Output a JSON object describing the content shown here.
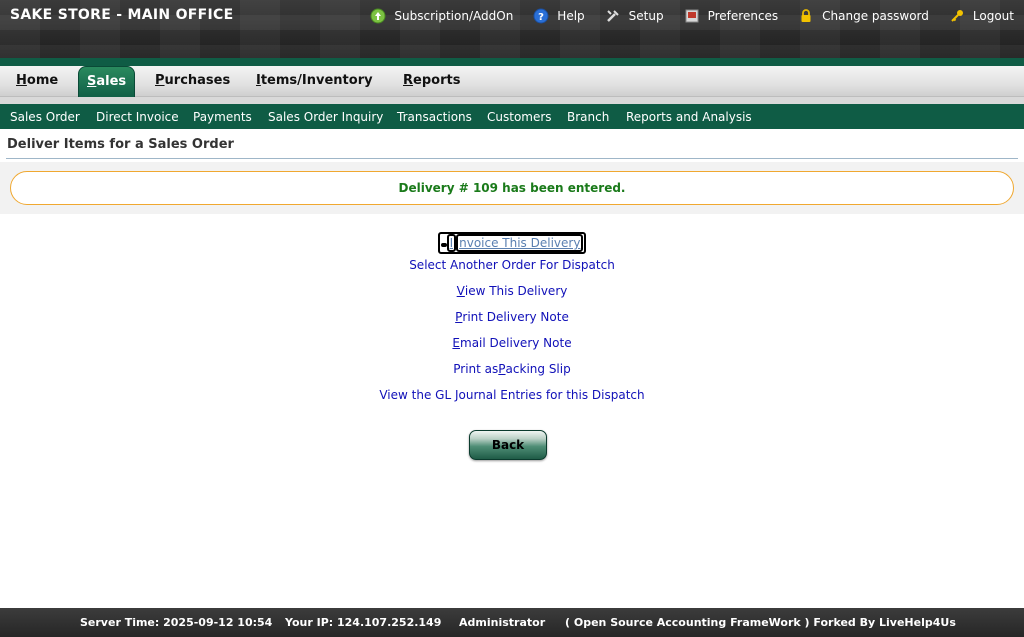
{
  "header": {
    "company": "SAKE STORE - MAIN OFFICE",
    "links": [
      {
        "label": "Subscription/AddOn",
        "icon": "upload-icon"
      },
      {
        "label": "Help",
        "icon": "help-icon"
      },
      {
        "label": "Setup",
        "icon": "wrench-icon"
      },
      {
        "label": "Preferences",
        "icon": "preferences-icon"
      },
      {
        "label": "Change password",
        "icon": "lock-icon"
      },
      {
        "label": "Logout",
        "icon": "key-icon"
      }
    ]
  },
  "main_tabs": [
    {
      "first": "H",
      "rest": "ome"
    },
    {
      "first": "S",
      "rest": "ales"
    },
    {
      "first": "P",
      "rest": "urchases"
    },
    {
      "first": "I",
      "rest": "tems/Inventory"
    },
    {
      "first": "R",
      "rest": "eports"
    }
  ],
  "sub_nav": [
    "Sales Order",
    "Direct Invoice",
    "Payments",
    "Sales Order Inquiry",
    "Transactions",
    "Customers",
    "Branch",
    "Reports and Analysis"
  ],
  "page": {
    "title": "Deliver Items for a Sales Order",
    "message": "Delivery # 109 has been entered."
  },
  "actions": [
    {
      "pre": "",
      "key": "I",
      "post": "nvoice This Delivery"
    },
    {
      "pre": "",
      "key": "",
      "post": "Select Another Order For Dispatch"
    },
    {
      "pre": "",
      "key": "V",
      "post": "iew This Delivery"
    },
    {
      "pre": "",
      "key": "P",
      "post": "rint Delivery Note"
    },
    {
      "pre": "",
      "key": "E",
      "post": "mail Delivery Note"
    },
    {
      "pre": "Print as ",
      "key": "P",
      "post": "acking Slip"
    },
    {
      "pre": "",
      "key": "",
      "post": "View the GL Journal Entries for this Dispatch"
    }
  ],
  "back_button": "Back",
  "footer": {
    "server_time": "Server Time: 2025-09-12 10:54",
    "ip": "Your IP: 124.107.252.149",
    "user": "Administrator",
    "credit": "( Open Source Accounting FrameWork ) Forked By LiveHelp4Us"
  }
}
